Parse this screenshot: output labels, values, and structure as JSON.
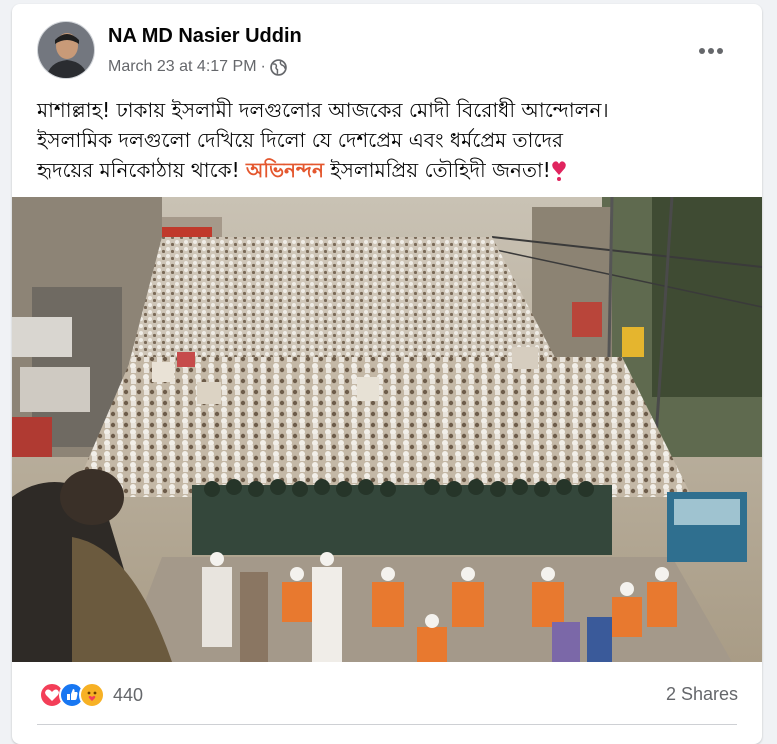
{
  "post": {
    "author_name": "NA MD Nasier Uddin",
    "timestamp": "March 23 at 4:17 PM",
    "separator": "·",
    "privacy_icon": "globe-icon",
    "more_icon": "more-horizontal-icon",
    "caption": {
      "line1": "মাশাল্লাহ! ঢাকায় ইসলামী দলগুলোর আজকের মোদী বিরোধী আন্দোলন।",
      "line2": "ইসলামিক দলগুলো দেখিয়ে দিলো যে দেশপ্রেম এবং ধর্মপ্রেম তাদের",
      "line3_start": "হৃদয়ের মনিকোঠায় থাকে!",
      "line3_highlight": "অভিনন্দন",
      "line3_end": "ইসলামপ্রিয় তৌহিদী জনতা!",
      "emoji": "heart-exclamation"
    },
    "highlight_color": "#e4572e"
  },
  "footer": {
    "reaction_icons": [
      "love-reaction-icon",
      "like-reaction-icon",
      "care-reaction-icon"
    ],
    "reaction_count": "440",
    "shares_label": "2 Shares"
  },
  "colors": {
    "background": "#f0f2f5",
    "card": "#ffffff",
    "secondary_text": "#65676b",
    "like_blue": "#1877f2",
    "love_red": "#f33e58",
    "care_yellow": "#f7b125"
  }
}
